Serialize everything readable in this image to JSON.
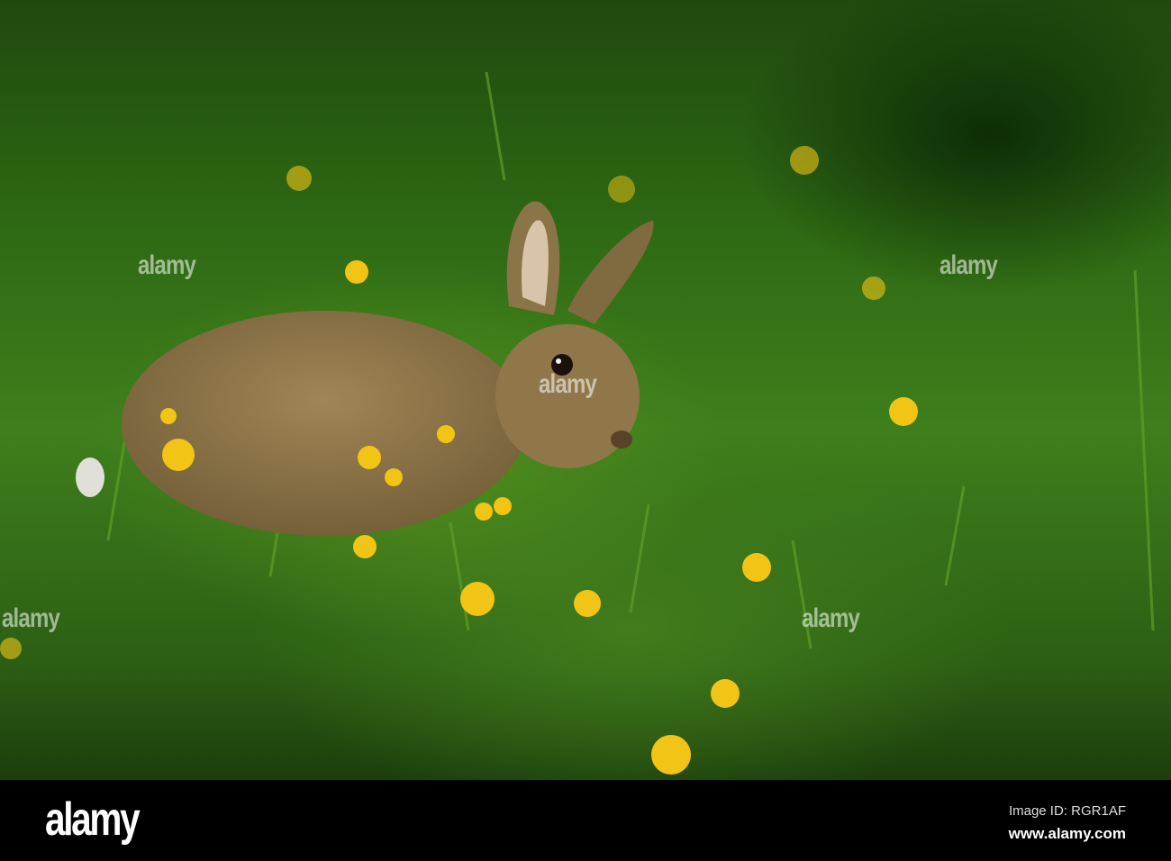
{
  "photo": {
    "subject": "wild rabbit in grass with yellow buttercups",
    "watermark": "alamy"
  },
  "footer": {
    "logo": "alamy",
    "image_id": "Image ID: RGR1AF",
    "website": "www.alamy.com"
  }
}
